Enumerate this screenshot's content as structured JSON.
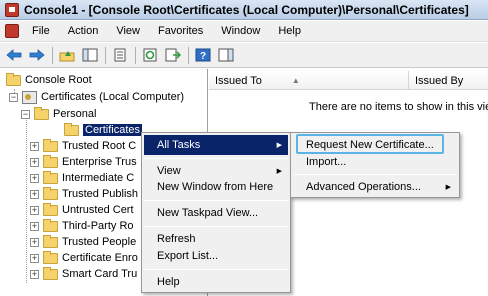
{
  "window": {
    "title": "Console1 - [Console Root\\Certificates (Local Computer)\\Personal\\Certificates]"
  },
  "menubar": {
    "items": [
      "File",
      "Action",
      "View",
      "Favorites",
      "Window",
      "Help"
    ]
  },
  "toolbar": {
    "icons": [
      "back-arrow-icon",
      "forward-arrow-icon",
      "up-folder-icon",
      "show-hide-tree-icon",
      "properties-icon",
      "refresh-icon",
      "export-list-icon",
      "help-icon",
      "show-hide-action-pane-icon"
    ]
  },
  "tree": {
    "root": "Console Root",
    "snapin": "Certificates (Local Computer)",
    "personal": "Personal",
    "certificates": "Certificates",
    "stores": [
      "Trusted Root C",
      "Enterprise Trus",
      "Intermediate C",
      "Trusted Publish",
      "Untrusted Cert",
      "Third-Party Ro",
      "Trusted People",
      "Certificate Enro",
      "Smart Card Tru"
    ]
  },
  "list": {
    "columns": [
      "Issued To",
      "Issued By"
    ],
    "empty_message": "There are no items to show in this vie"
  },
  "context_menu": {
    "items": [
      "All Tasks",
      "View",
      "New Window from Here",
      "New Taskpad View...",
      "Refresh",
      "Export List...",
      "Help"
    ]
  },
  "submenu": {
    "items": [
      "Request New Certificate...",
      "Import...",
      "Advanced Operations..."
    ]
  },
  "colors": {
    "selection": "#0a246a",
    "focus_border": "#5ab4e6",
    "menu_background": "#f0f0f0",
    "folder": "#f5d26a"
  }
}
